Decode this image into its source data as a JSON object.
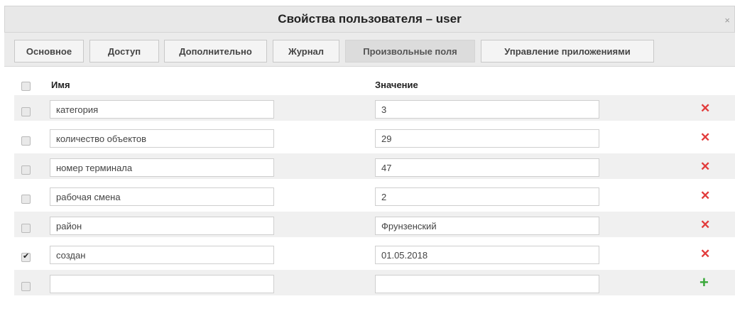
{
  "dialog": {
    "title": "Свойства пользователя – user",
    "close_glyph": "×"
  },
  "tabs": [
    {
      "label": "Основное"
    },
    {
      "label": "Доступ"
    },
    {
      "label": "Дополнительно"
    },
    {
      "label": "Журнал"
    },
    {
      "label": "Произвольные поля",
      "active": true
    },
    {
      "label": "Управление приложениями"
    }
  ],
  "table": {
    "headers": {
      "name": "Имя",
      "value": "Значение"
    },
    "rows": [
      {
        "name": "категория",
        "value": "3",
        "checked": false
      },
      {
        "name": "количество объектов",
        "value": "29",
        "checked": false
      },
      {
        "name": "номер терминала",
        "value": "47",
        "checked": false
      },
      {
        "name": "рабочая смена",
        "value": "2",
        "checked": false
      },
      {
        "name": "район",
        "value": "Фрунзенский",
        "checked": false
      },
      {
        "name": "создан",
        "value": "01.05.2018",
        "checked": true
      },
      {
        "name": "",
        "value": "",
        "checked": false
      }
    ]
  },
  "icons": {
    "delete": "✕",
    "add": "+",
    "check": "✔"
  },
  "colors": {
    "delete": "#e23b3b",
    "add": "#38a838",
    "active_tab": "#dcdcdc"
  }
}
